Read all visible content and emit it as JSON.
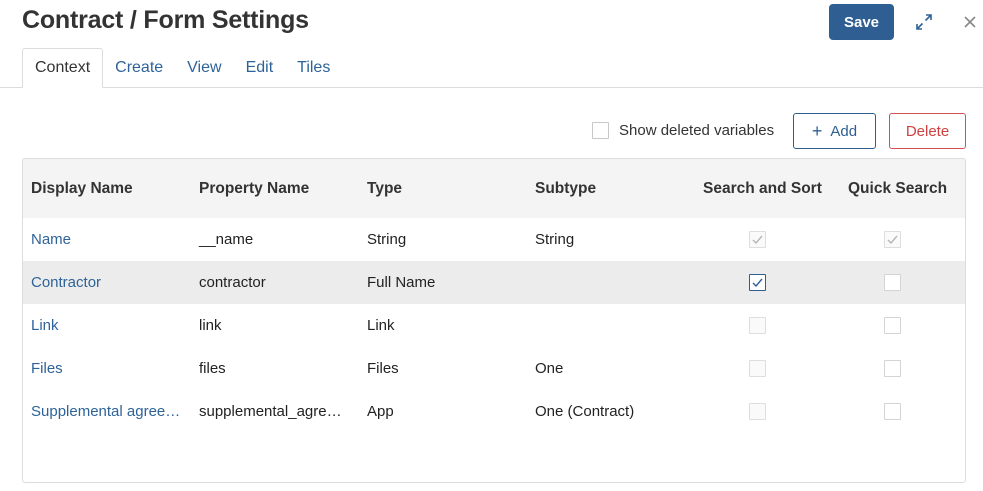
{
  "header": {
    "title": "Contract / Form Settings",
    "save_label": "Save"
  },
  "tabs": [
    {
      "label": "Context",
      "active": true
    },
    {
      "label": "Create",
      "active": false
    },
    {
      "label": "View",
      "active": false
    },
    {
      "label": "Edit",
      "active": false
    },
    {
      "label": "Tiles",
      "active": false
    }
  ],
  "toolbar": {
    "show_deleted_label": "Show deleted variables",
    "show_deleted_checked": false,
    "add_label": "Add",
    "delete_label": "Delete"
  },
  "table": {
    "columns": [
      "Display Name",
      "Property Name",
      "Type",
      "Subtype",
      "Search and Sort",
      "Quick Search"
    ],
    "rows": [
      {
        "display_name": "Name",
        "property_name": "__name",
        "type": "String",
        "subtype": "String",
        "search_sort": true,
        "search_sort_disabled": true,
        "quick_search": true,
        "quick_search_disabled": true,
        "highlight": false
      },
      {
        "display_name": "Contractor",
        "property_name": "contractor",
        "type": "Full Name",
        "subtype": "",
        "search_sort": true,
        "search_sort_disabled": false,
        "quick_search": false,
        "quick_search_disabled": false,
        "highlight": true
      },
      {
        "display_name": "Link",
        "property_name": "link",
        "type": "Link",
        "subtype": "",
        "search_sort": false,
        "search_sort_disabled": true,
        "quick_search": false,
        "quick_search_disabled": false,
        "highlight": false
      },
      {
        "display_name": "Files",
        "property_name": "files",
        "type": "Files",
        "subtype": "One",
        "search_sort": false,
        "search_sort_disabled": true,
        "quick_search": false,
        "quick_search_disabled": false,
        "highlight": false
      },
      {
        "display_name": "Supplemental agree…",
        "property_name": "supplemental_agre…",
        "type": "App",
        "subtype": "One (Contract)",
        "search_sort": false,
        "search_sort_disabled": true,
        "quick_search": false,
        "quick_search_disabled": false,
        "highlight": false
      }
    ]
  },
  "colors": {
    "accent": "#2f5f92",
    "link": "#2e6399",
    "danger": "#d04040",
    "row_highlight": "#ececec"
  },
  "icons": {
    "expand": "expand-icon",
    "close": "close-icon",
    "add": "plus-icon",
    "check": "check-icon"
  }
}
